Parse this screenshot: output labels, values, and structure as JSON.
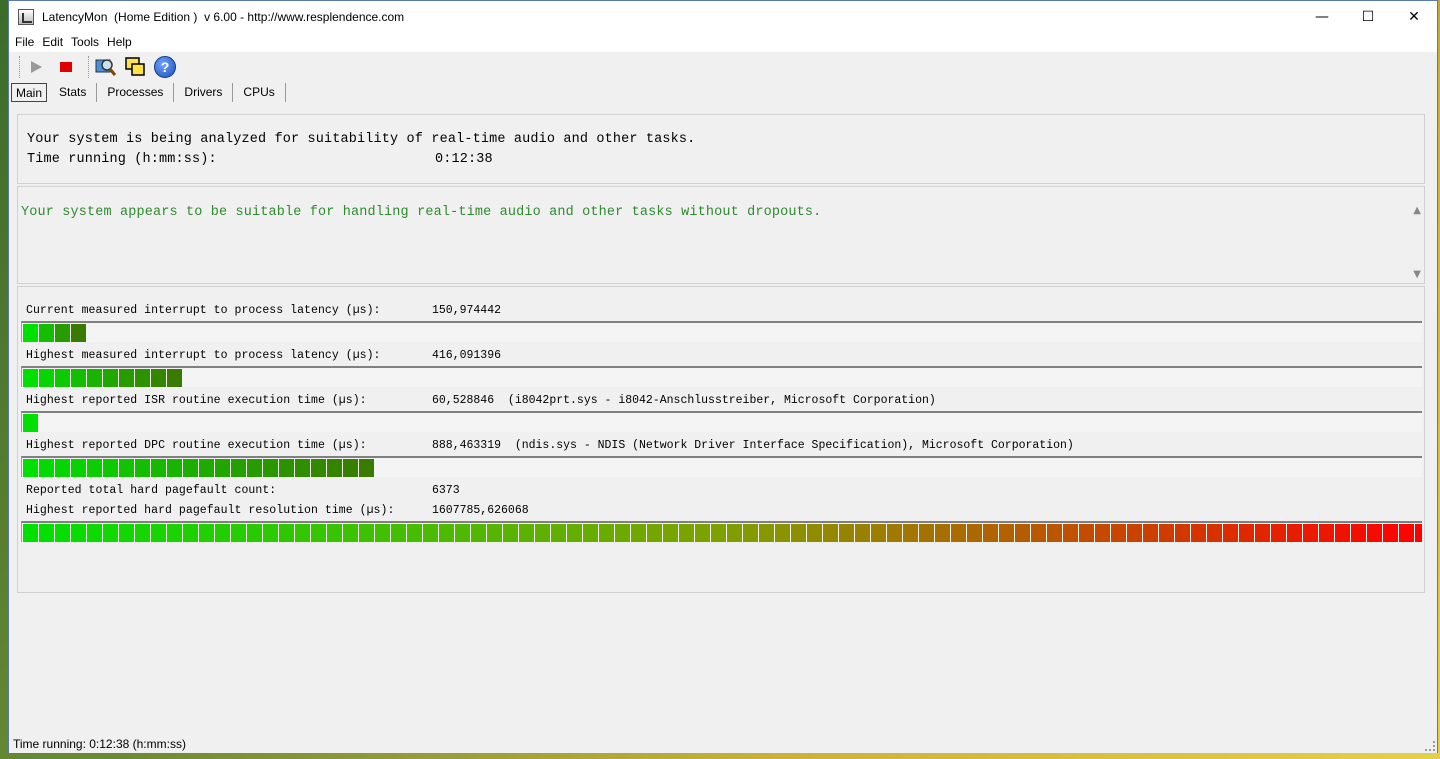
{
  "window": {
    "title": "LatencyMon  (Home Edition )  v 6.00 - http://www.resplendence.com"
  },
  "window_controls": {
    "minimize": "—",
    "maximize": "☐",
    "close": "✕"
  },
  "menu": [
    "File",
    "Edit",
    "Tools",
    "Help"
  ],
  "toolbar": {
    "help_glyph": "?"
  },
  "tabs": [
    "Main",
    "Stats",
    "Processes",
    "Drivers",
    "CPUs"
  ],
  "summary": {
    "line1": "Your system is being analyzed for suitability of real-time audio and other tasks.",
    "time_label": "Time running (h:mm:ss):",
    "time_value": "0:12:38"
  },
  "verdict": {
    "text": "Your system appears to be suitable for handling real-time audio and other tasks without dropouts.",
    "color": "#2e8b2e"
  },
  "measurements": [
    {
      "label": "Current measured interrupt to process latency (µs):",
      "value": "150,974442",
      "bar_segments": 4
    },
    {
      "label": "Highest measured interrupt to process latency (µs):",
      "value": "416,091396",
      "bar_segments": 10
    },
    {
      "label": "Highest reported ISR routine execution time (µs):",
      "value": "60,528846  (i8042prt.sys - i8042-Anschlusstreiber, Microsoft Corporation)",
      "bar_segments": 1
    },
    {
      "label": "Highest reported DPC routine execution time (µs):",
      "value": "888,463319  (ndis.sys - NDIS (Network Driver Interface Specification), Microsoft Corporation)",
      "bar_segments": 22
    },
    {
      "label": "Reported total hard pagefault count:",
      "value": "6373"
    },
    {
      "label": "Highest reported hard pagefault resolution time (µs):",
      "value": "1607785,626068",
      "bar_segments": 88
    }
  ],
  "bar_colors": {
    "start": "#00e000",
    "end": "#ff0000",
    "mid": "#3a7a00"
  },
  "status": {
    "text": "Time running: 0:12:38  (h:mm:ss)"
  }
}
